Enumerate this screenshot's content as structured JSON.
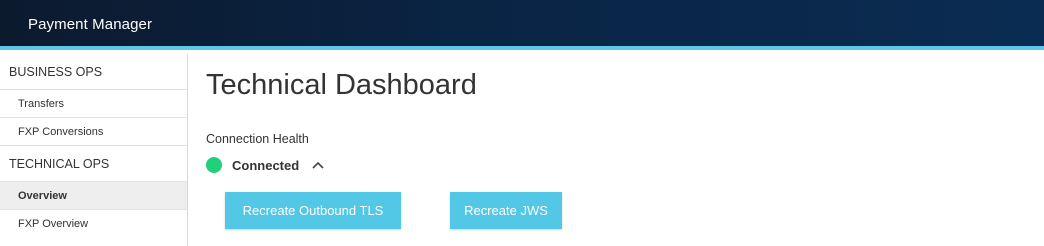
{
  "app": {
    "title": "Payment Manager"
  },
  "sidebar": {
    "sections": [
      {
        "label": "BUSINESS OPS",
        "items": [
          "Transfers",
          "FXP Conversions"
        ]
      },
      {
        "label": "TECHNICAL OPS",
        "items": [
          "Overview",
          "FXP Overview"
        ]
      }
    ],
    "active_item": "Overview"
  },
  "main": {
    "title": "Technical Dashboard",
    "connection_label": "Connection Health",
    "status_text": "Connected",
    "status_color": "#22d07a",
    "buttons": {
      "tls": "Recreate Outbound TLS",
      "jws": "Recreate JWS"
    }
  },
  "colors": {
    "accent": "#52c7e6",
    "header_bg": "#0b2444",
    "header_border": "#5cc8e8"
  },
  "icons": {
    "status": "status-dot-icon",
    "toggle": "chevron-up-icon"
  }
}
